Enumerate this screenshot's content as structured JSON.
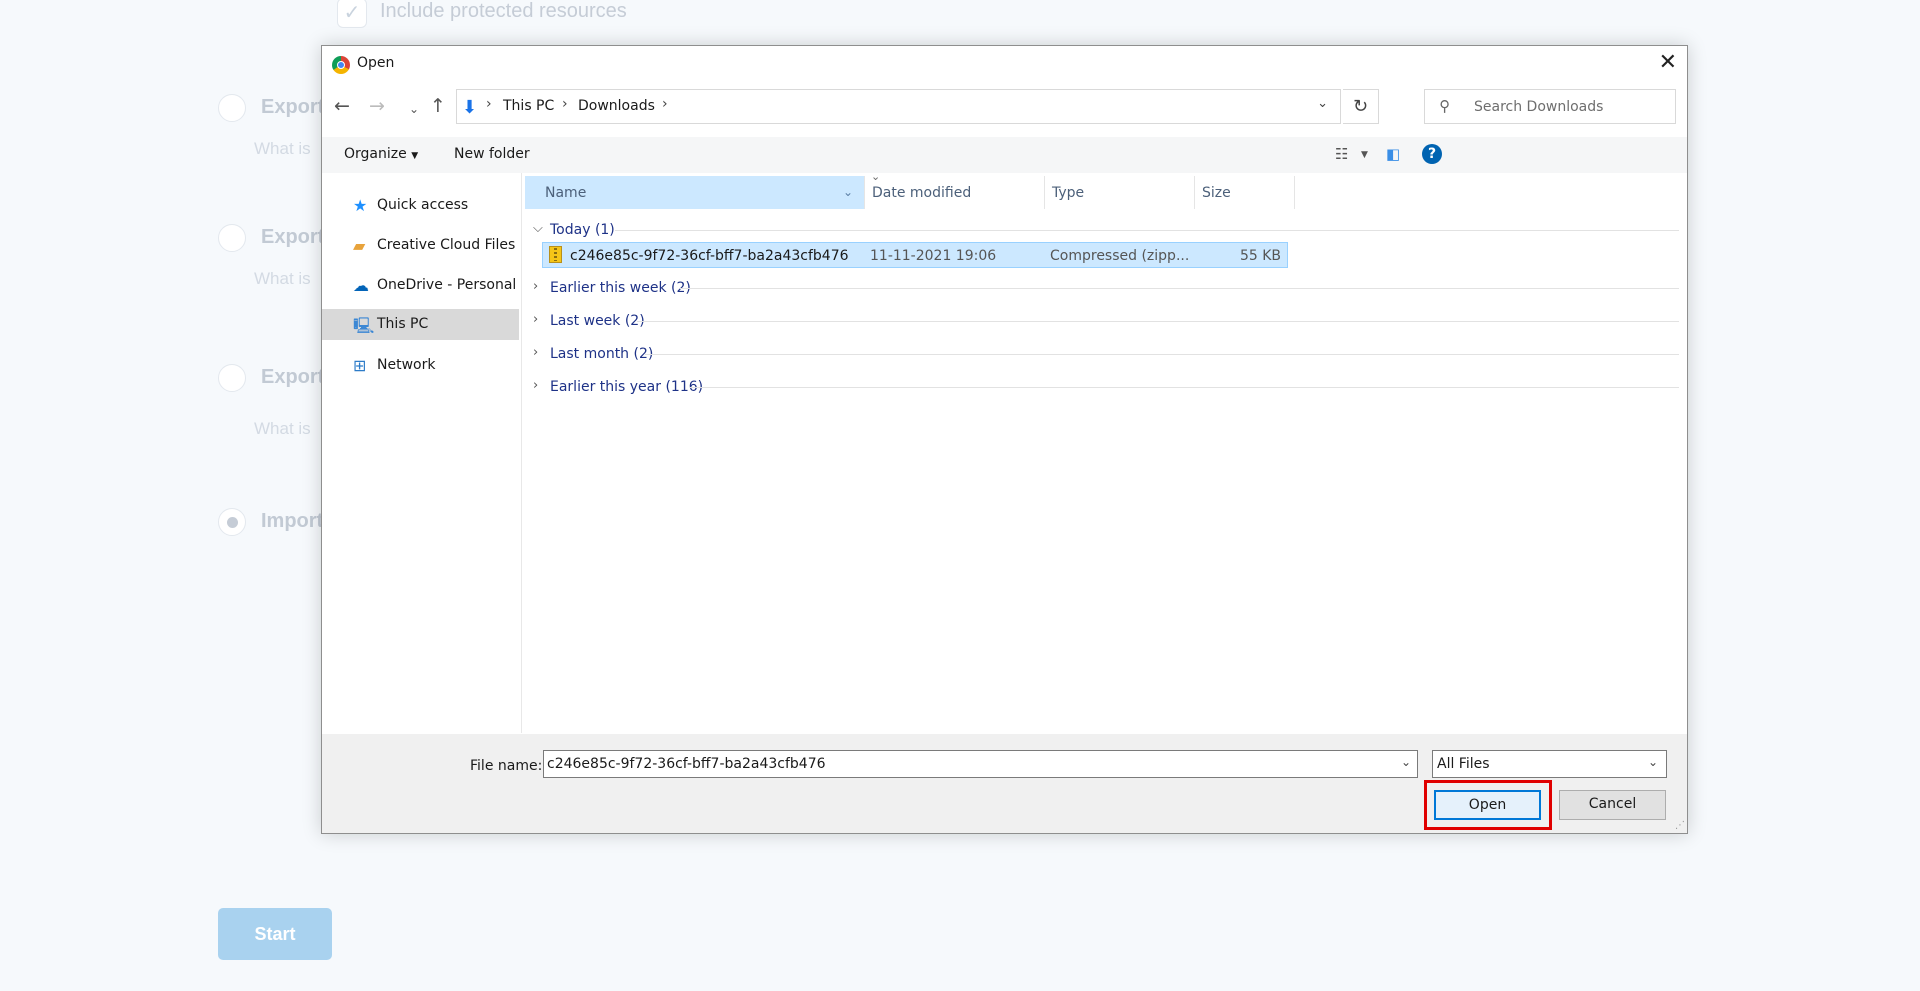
{
  "background": {
    "checkbox_label": "Include protected resources",
    "options": [
      {
        "label": "Export",
        "sub": "What is"
      },
      {
        "label": "Export",
        "sub": "What is"
      },
      {
        "label": "Export",
        "sub": "What is"
      },
      {
        "label": "Import"
      }
    ],
    "start_label": "Start"
  },
  "dialog": {
    "title": "Open",
    "close_glyph": "✕",
    "address": {
      "crumbs": [
        "This PC",
        "Downloads"
      ]
    },
    "search_placeholder": "Search Downloads",
    "toolbar": {
      "organize": "Organize",
      "new_folder": "New folder",
      "help": "?"
    },
    "nav": [
      {
        "label": "Quick access",
        "icon": "star-icon"
      },
      {
        "label": "Creative Cloud Files",
        "icon": "creative-cloud-icon"
      },
      {
        "label": "OneDrive - Personal",
        "icon": "cloud-icon"
      },
      {
        "label": "This PC",
        "icon": "computer-icon",
        "selected": true
      },
      {
        "label": "Network",
        "icon": "network-icon"
      }
    ],
    "columns": {
      "name": "Name",
      "date": "Date modified",
      "type": "Type",
      "size": "Size"
    },
    "groups": [
      {
        "label": "Today (1)",
        "expanded": true
      },
      {
        "label": "Earlier this week (2)"
      },
      {
        "label": "Last week (2)"
      },
      {
        "label": "Last month (2)"
      },
      {
        "label": "Earlier this year (116)"
      }
    ],
    "file": {
      "name": "c246e85c-9f72-36cf-bff7-ba2a43cfb476",
      "date": "11-11-2021 19:06",
      "type": "Compressed (zipp...",
      "size": "55 KB"
    },
    "file_name_label": "File name:",
    "file_name_value": "c246e85c-9f72-36cf-bff7-ba2a43cfb476",
    "file_type": "All Files",
    "open_label": "Open",
    "cancel_label": "Cancel"
  },
  "colors": {
    "selection": "#cce8ff",
    "accent": "#0078d7",
    "highlight_box": "#e00000",
    "start_button": "#a9d2ef"
  }
}
